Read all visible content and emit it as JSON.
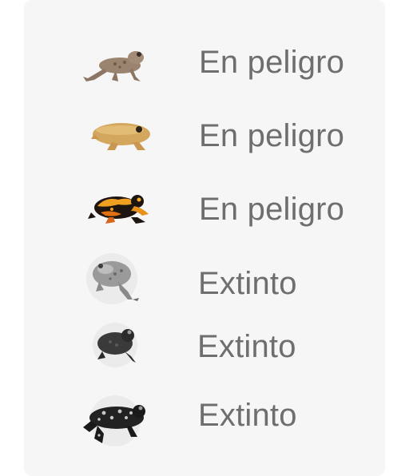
{
  "species_list": [
    {
      "icon": "brown-frog-icon",
      "status": "En peligro"
    },
    {
      "icon": "tan-frog-icon",
      "status": "En peligro"
    },
    {
      "icon": "harlequin-frog-icon",
      "status": "En peligro"
    },
    {
      "icon": "grey-toad-icon",
      "status": "Extinto"
    },
    {
      "icon": "dark-toad-icon",
      "status": "Extinto"
    },
    {
      "icon": "spotted-black-toad-icon",
      "status": "Extinto"
    }
  ],
  "colors": {
    "card_background": "#f6f6f6",
    "status_text": "#6e6e6e"
  }
}
